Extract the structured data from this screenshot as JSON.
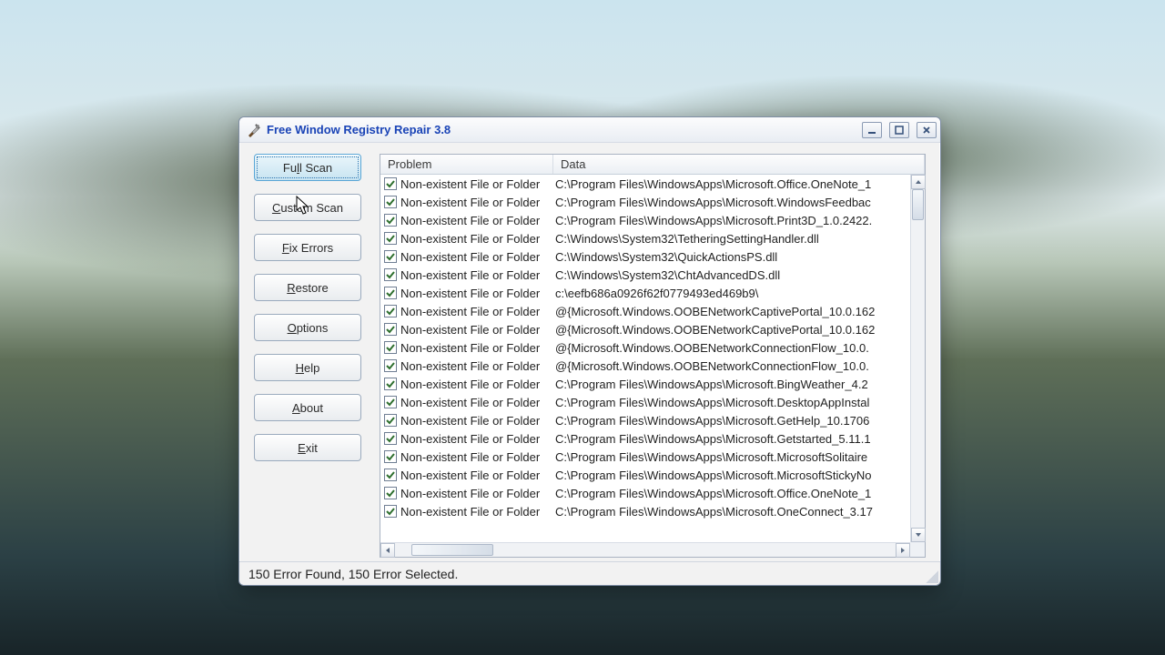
{
  "window": {
    "title": "Free Window Registry Repair 3.8"
  },
  "sidebar": {
    "full_scan": "Full Scan",
    "custom_scan": "Custom Scan",
    "fix_errors": "Fix Errors",
    "restore": "Restore",
    "options": "Options",
    "help": "Help",
    "about": "About",
    "exit": "Exit",
    "underline_index": {
      "full_scan": 2,
      "custom_scan": 0,
      "fix_errors": 0,
      "restore": 0,
      "options": 0,
      "help": 0,
      "about": 0,
      "exit": 0
    }
  },
  "columns": {
    "problem": "Problem",
    "data": "Data"
  },
  "rows": [
    {
      "problem": "Non-existent File or Folder",
      "data": "C:\\Program Files\\WindowsApps\\Microsoft.Office.OneNote_1"
    },
    {
      "problem": "Non-existent File or Folder",
      "data": "C:\\Program Files\\WindowsApps\\Microsoft.WindowsFeedbac"
    },
    {
      "problem": "Non-existent File or Folder",
      "data": "C:\\Program Files\\WindowsApps\\Microsoft.Print3D_1.0.2422."
    },
    {
      "problem": "Non-existent File or Folder",
      "data": "C:\\Windows\\System32\\TetheringSettingHandler.dll"
    },
    {
      "problem": "Non-existent File or Folder",
      "data": "C:\\Windows\\System32\\QuickActionsPS.dll"
    },
    {
      "problem": "Non-existent File or Folder",
      "data": "C:\\Windows\\System32\\ChtAdvancedDS.dll"
    },
    {
      "problem": "Non-existent File or Folder",
      "data": "c:\\eefb686a0926f62f0779493ed469b9\\"
    },
    {
      "problem": "Non-existent File or Folder",
      "data": "@{Microsoft.Windows.OOBENetworkCaptivePortal_10.0.162"
    },
    {
      "problem": "Non-existent File or Folder",
      "data": "@{Microsoft.Windows.OOBENetworkCaptivePortal_10.0.162"
    },
    {
      "problem": "Non-existent File or Folder",
      "data": "@{Microsoft.Windows.OOBENetworkConnectionFlow_10.0."
    },
    {
      "problem": "Non-existent File or Folder",
      "data": "@{Microsoft.Windows.OOBENetworkConnectionFlow_10.0."
    },
    {
      "problem": "Non-existent File or Folder",
      "data": "C:\\Program Files\\WindowsApps\\Microsoft.BingWeather_4.2"
    },
    {
      "problem": "Non-existent File or Folder",
      "data": "C:\\Program Files\\WindowsApps\\Microsoft.DesktopAppInstal"
    },
    {
      "problem": "Non-existent File or Folder",
      "data": "C:\\Program Files\\WindowsApps\\Microsoft.GetHelp_10.1706"
    },
    {
      "problem": "Non-existent File or Folder",
      "data": "C:\\Program Files\\WindowsApps\\Microsoft.Getstarted_5.11.1"
    },
    {
      "problem": "Non-existent File or Folder",
      "data": "C:\\Program Files\\WindowsApps\\Microsoft.MicrosoftSolitaire"
    },
    {
      "problem": "Non-existent File or Folder",
      "data": "C:\\Program Files\\WindowsApps\\Microsoft.MicrosoftStickyNo"
    },
    {
      "problem": "Non-existent File or Folder",
      "data": "C:\\Program Files\\WindowsApps\\Microsoft.Office.OneNote_1"
    },
    {
      "problem": "Non-existent File or Folder",
      "data": "C:\\Program Files\\WindowsApps\\Microsoft.OneConnect_3.17"
    }
  ],
  "status": "150 Error Found,  150 Error Selected."
}
